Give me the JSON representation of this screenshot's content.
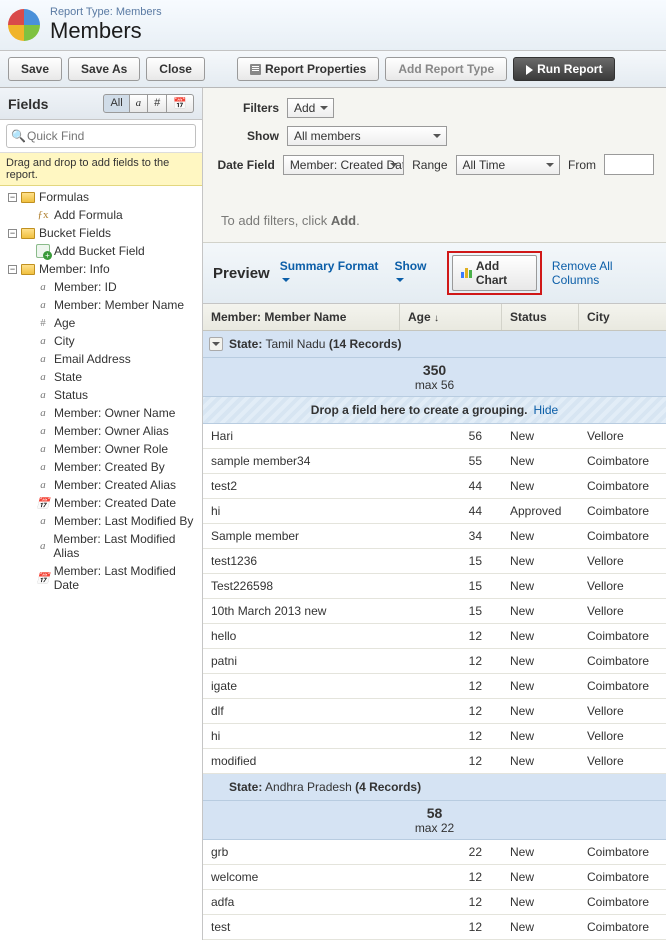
{
  "header": {
    "report_type_label": "Report Type: Members",
    "title": "Members"
  },
  "toolbar": {
    "save": "Save",
    "save_as": "Save As",
    "close": "Close",
    "report_props": "Report Properties",
    "add_report_type": "Add Report Type",
    "run_report": "Run Report"
  },
  "sidebar": {
    "title": "Fields",
    "toggles": {
      "all": "All",
      "a": "a",
      "hash": "#",
      "cal": "📅"
    },
    "search_placeholder": "Quick Find",
    "drag_hint": "Drag and drop to add fields to the report.",
    "folders": {
      "formulas": {
        "label": "Formulas",
        "child": "Add Formula"
      },
      "buckets": {
        "label": "Bucket Fields",
        "child": "Add Bucket Field"
      },
      "info": {
        "label": "Member: Info",
        "fields": [
          {
            "type": "a",
            "label": "Member: ID"
          },
          {
            "type": "a",
            "label": "Member: Member Name"
          },
          {
            "type": "#",
            "label": "Age"
          },
          {
            "type": "a",
            "label": "City"
          },
          {
            "type": "a",
            "label": "Email Address"
          },
          {
            "type": "a",
            "label": "State"
          },
          {
            "type": "a",
            "label": "Status"
          },
          {
            "type": "a",
            "label": "Member: Owner Name"
          },
          {
            "type": "a",
            "label": "Member: Owner Alias"
          },
          {
            "type": "a",
            "label": "Member: Owner Role"
          },
          {
            "type": "a",
            "label": "Member: Created By"
          },
          {
            "type": "a",
            "label": "Member: Created Alias"
          },
          {
            "type": "d",
            "label": "Member: Created Date"
          },
          {
            "type": "a",
            "label": "Member: Last Modified By"
          },
          {
            "type": "a",
            "label": "Member: Last Modified Alias"
          },
          {
            "type": "d",
            "label": "Member: Last Modified Date"
          }
        ]
      }
    }
  },
  "filters": {
    "filters_label": "Filters",
    "add_label": "Add",
    "show_label": "Show",
    "show_value": "All members",
    "datefield_label": "Date Field",
    "datefield_value": "Member: Created Date",
    "range_label": "Range",
    "range_value": "All Time",
    "from_label": "From",
    "tip_prefix": "To add filters, click ",
    "tip_bold": "Add",
    "tip_suffix": "."
  },
  "preview": {
    "title": "Preview",
    "format_link": "Summary Format",
    "show_link": "Show",
    "add_chart": "Add Chart",
    "remove_all": "Remove All Columns"
  },
  "columns": {
    "name": "Member: Member Name",
    "age": "Age",
    "status": "Status",
    "city": "City"
  },
  "drop_hint": "Drop a field here to create a grouping.",
  "hide_label": "Hide",
  "state_label": "State:",
  "groups": [
    {
      "state": "Tamil Nadu",
      "records_text": "(14 Records)",
      "sum": "350",
      "max": "max 56",
      "rows": [
        {
          "name": "Hari",
          "age": "56",
          "status": "New",
          "city": "Vellore"
        },
        {
          "name": "sample member34",
          "age": "55",
          "status": "New",
          "city": "Coimbatore"
        },
        {
          "name": "test2",
          "age": "44",
          "status": "New",
          "city": "Coimbatore"
        },
        {
          "name": "hi",
          "age": "44",
          "status": "Approved",
          "city": "Coimbatore"
        },
        {
          "name": "Sample member",
          "age": "34",
          "status": "New",
          "city": "Coimbatore"
        },
        {
          "name": "test1236",
          "age": "15",
          "status": "New",
          "city": "Vellore"
        },
        {
          "name": "Test226598",
          "age": "15",
          "status": "New",
          "city": "Vellore"
        },
        {
          "name": "10th March 2013 new",
          "age": "15",
          "status": "New",
          "city": "Vellore"
        },
        {
          "name": "hello",
          "age": "12",
          "status": "New",
          "city": "Coimbatore"
        },
        {
          "name": "patni",
          "age": "12",
          "status": "New",
          "city": "Coimbatore"
        },
        {
          "name": "igate",
          "age": "12",
          "status": "New",
          "city": "Coimbatore"
        },
        {
          "name": "dlf",
          "age": "12",
          "status": "New",
          "city": "Vellore"
        },
        {
          "name": "hi",
          "age": "12",
          "status": "New",
          "city": "Vellore"
        },
        {
          "name": "modified",
          "age": "12",
          "status": "New",
          "city": "Vellore"
        }
      ]
    },
    {
      "state": "Andhra Pradesh",
      "records_text": "(4 Records)",
      "sum": "58",
      "max": "max 22",
      "rows": [
        {
          "name": "grb",
          "age": "22",
          "status": "New",
          "city": "Coimbatore"
        },
        {
          "name": "welcome",
          "age": "12",
          "status": "New",
          "city": "Coimbatore"
        },
        {
          "name": "adfa",
          "age": "12",
          "status": "New",
          "city": "Coimbatore"
        },
        {
          "name": "test",
          "age": "12",
          "status": "New",
          "city": "Coimbatore"
        }
      ]
    }
  ]
}
